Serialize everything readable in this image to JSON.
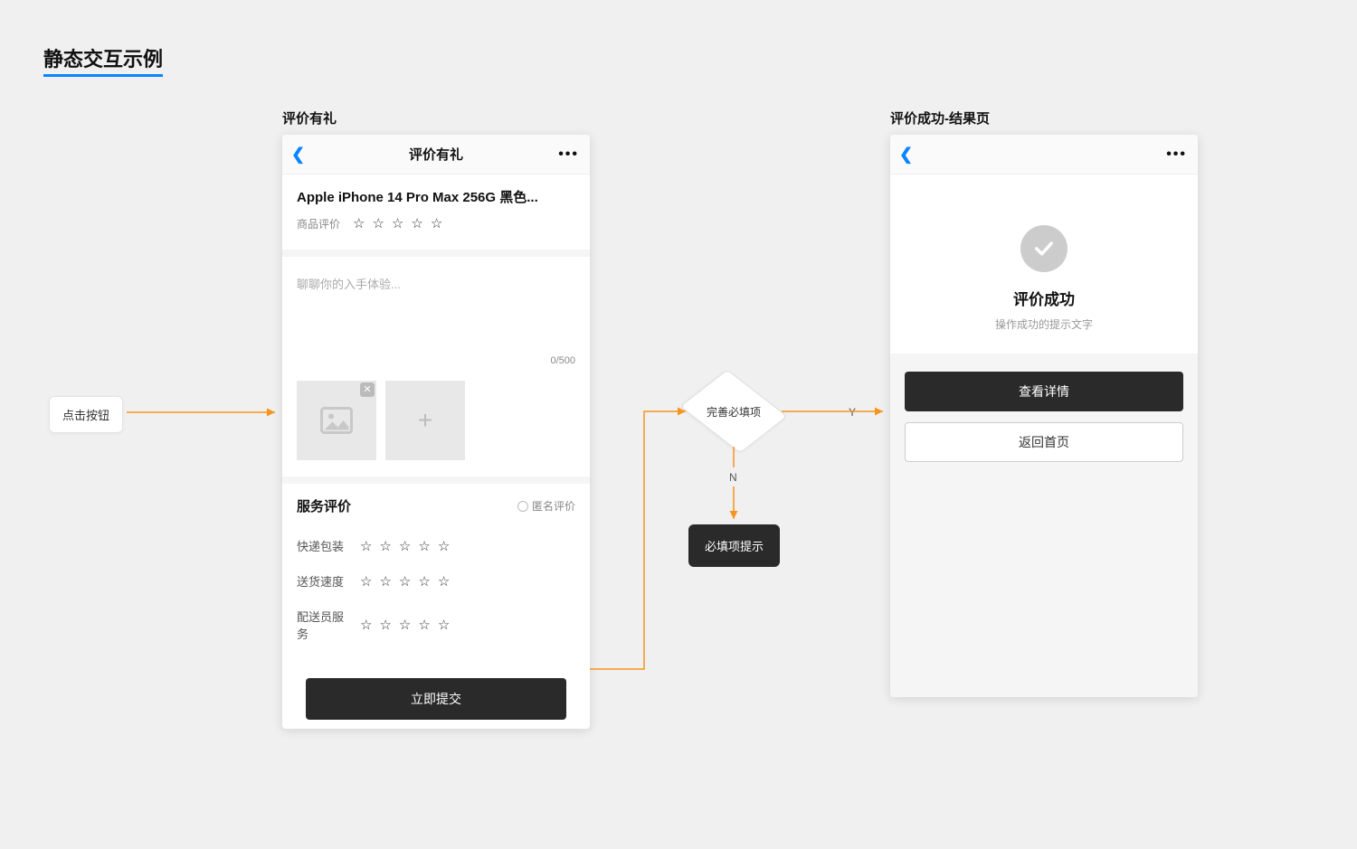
{
  "page_title": "静态交互示例",
  "trigger_label": "点击按钮",
  "phone_a": {
    "section_label": "评价有礼",
    "nav_title": "评价有礼",
    "product_title": "Apple iPhone 14 Pro Max 256G 黑色...",
    "product_rating_label": "商品评价",
    "textarea_placeholder": "聊聊你的入手体验...",
    "char_count": "0/500",
    "service_title": "服务评价",
    "anonymous_label": "匿名评价",
    "service_rows": [
      {
        "label": "快递包装"
      },
      {
        "label": "送货速度"
      },
      {
        "label": "配送员服务"
      }
    ],
    "submit_label": "立即提交"
  },
  "decision": {
    "label": "完善必填项",
    "yes": "Y",
    "no": "N"
  },
  "toast": "必填项提示",
  "phone_b": {
    "section_label": "评价成功-结果页",
    "result_title": "评价成功",
    "result_sub": "操作成功的提示文字",
    "action_primary": "查看详情",
    "action_secondary": "返回首页"
  }
}
